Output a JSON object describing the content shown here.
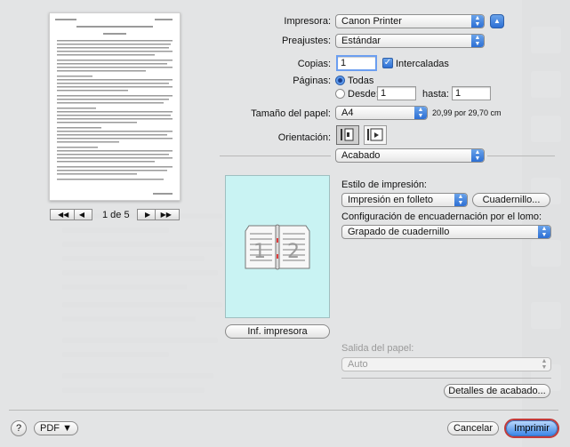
{
  "printer": {
    "label": "Impresora:",
    "value": "Canon Printer"
  },
  "presets": {
    "label": "Preajustes:",
    "value": "Estándar"
  },
  "copies": {
    "label": "Copias:",
    "value": "1",
    "collate_label": "Intercaladas"
  },
  "pages": {
    "label": "Páginas:",
    "all_label": "Todas",
    "from_label": "Desde:",
    "from_value": "1",
    "to_label": "hasta:",
    "to_value": "1"
  },
  "paper_size": {
    "label": "Tamaño del papel:",
    "value": "A4",
    "dimensions": "20,99 por 29,70 cm"
  },
  "orientation": {
    "label": "Orientación:"
  },
  "section": {
    "value": "Acabado"
  },
  "print_style": {
    "label": "Estilo de impresión:",
    "value": "Impresión en folleto",
    "button": "Cuadernillo..."
  },
  "binding": {
    "label": "Configuración de encuadernación por el lomo:",
    "value": "Grapado de cuadernillo"
  },
  "booklet_pages": [
    "1",
    "2"
  ],
  "printer_info_button": "Inf. impresora",
  "paper_output": {
    "label": "Salida del papel:",
    "value": "Auto"
  },
  "finishing_details_button": "Detalles de acabado...",
  "preview": {
    "page_indicator": "1 de 5"
  },
  "bottom": {
    "help": "?",
    "pdf": "PDF ▼",
    "cancel": "Cancelar",
    "print": "Imprimir"
  },
  "colors": {
    "accent": "#3b86e8",
    "booklet_bg": "#c9f3f3",
    "focus": "#c23a3a"
  }
}
